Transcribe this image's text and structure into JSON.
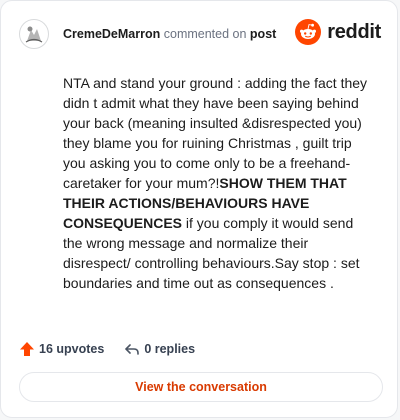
{
  "header": {
    "username": "CremeDeMarron",
    "action": "commented on",
    "post_link": "post",
    "brand": "reddit",
    "avatar_icon": "user-avatar-icon",
    "brand_icon": "reddit-alien-icon"
  },
  "comment": {
    "text_part1": "NTA and stand your ground : adding the fact they didn t admit what they have been saying behind your back (meaning insulted &disrespected you) they blame you for ruining Christmas , guilt trip you asking you to come only to be a freehand-caretaker for your mum?!",
    "text_bold": "SHOW THEM THAT THEIR ACTIONS/BEHAVIOURS HAVE CONSEQUENCES",
    "text_part2": " if you comply it would send the wrong message and normalize their disrespect/ controlling behaviours.Say stop : set boundaries and time out as consequences ."
  },
  "footer": {
    "upvotes_label": "16 upvotes",
    "replies_label": "0 replies",
    "upvote_icon": "upvote-arrow-icon",
    "reply_icon": "reply-icon"
  },
  "cta": {
    "label": "View the conversation"
  },
  "colors": {
    "brand_orange": "#ff4500",
    "cta_text": "#d93a00",
    "text_primary": "#1c1c1c",
    "text_secondary": "#6b7280"
  }
}
